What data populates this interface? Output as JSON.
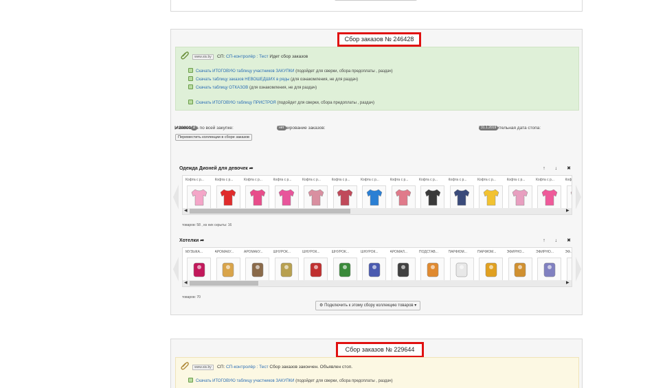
{
  "panel1": {
    "title": "Сбор заказов № 246428",
    "source_badge": "www.sis.by",
    "sp_prefix": "СП:",
    "sp_link": "СП-контролёр : Тест",
    "sp_status": "Идет сбор заказов",
    "downloads": [
      {
        "link": "Скачать ИТОГОВУЮ таблицу участников ЗАКУПКИ",
        "note": " (подойдет для сверки, сбора предоплаты , раздач)"
      },
      {
        "link": "Скачать таблицу заказов НЕВОШЕДШИХ в ряды",
        "note": " (для ознакомления, не для раздач)"
      },
      {
        "link": "Скачать таблицу ОТКАЗОВ",
        "note": " (для ознакомления, не для раздач)"
      },
      {
        "link": "Скачать ИТОГОВУЮ таблицу ПРИСТРОЯ",
        "note": " (подойдет для сверки, сбора предоплаты , раздач)"
      }
    ],
    "min_label": "Минималка по всей закупке:",
    "min_value": "20000",
    "min_pill": "₽",
    "booking_label": "Бронирование заказов:",
    "booking_value": "нет",
    "date_label": "Предварительная дата стопа:",
    "date_value": "31.1.2019",
    "move_button": "Переместить коллекции в сборе заказов",
    "controls": "↑ ↓ ✖",
    "collections": [
      {
        "title": "Одежда Дионей для девочек",
        "count": "товаров: 58 , из них скрыты: 16",
        "items": [
          "Кофта с р...",
          "Кофта с р...",
          "Кофта с р...",
          "Кофта с р...",
          "Кофта с р...",
          "Кофта с р...",
          "Кофта с р...",
          "Кофта с р...",
          "Кофта с р...",
          "Кофта с р...",
          "Кофта с р...",
          "Кофта с р...",
          "Кофта с р...",
          "Кофта с р..."
        ]
      },
      {
        "title": "Хотелки",
        "count": "товаров: 70",
        "items": [
          "МУЗЫКА...",
          "АРОМАКУ...",
          "АРОМАКУ...",
          "ШНУРОК...",
          "ШНУРОК...",
          "ШНУРОК...",
          "ШНУРОК...",
          "АРОМАЛ...",
          "ПОДСТАВ...",
          "ПАРФЮМ...",
          "ПАРФЮМ...",
          "ЭФИРНО...",
          "ЭФИРНО...",
          "ЭФ..."
        ]
      }
    ],
    "connect_button": "Подключить к этому сбору коллекцию товаров",
    "scroll_left": "◀",
    "scroll_right": "▶"
  },
  "panel2": {
    "title": "Сбор заказов № 229644",
    "source_badge": "www.sis.by",
    "sp_prefix": "СП:",
    "sp_link": "СП-контролёр : Тест",
    "sp_status": "Сбор заказов закончен. Объявлен стоп.",
    "downloads": [
      {
        "link": "Скачать ИТОГОВУЮ таблицу участников ЗАКУПКИ",
        "note": " (подойдет для сверки, сбора предоплаты , раздач)"
      }
    ]
  },
  "colors": {
    "highlight": "#e01010",
    "info_green": "#dff0d8",
    "info_yellow": "#fcf8e3",
    "link": "#2a6db5"
  },
  "icons": {
    "clip": "paperclip-icon",
    "download": "spreadsheet-icon",
    "edit": "pencil-icon",
    "gear": "gear-icon"
  }
}
